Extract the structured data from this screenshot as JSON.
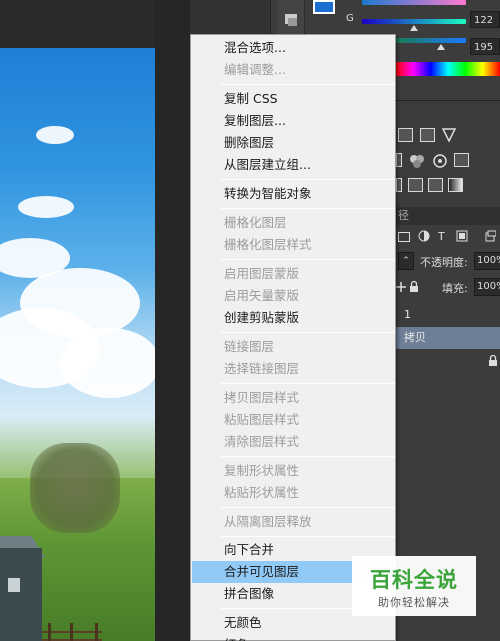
{
  "color_panel": {
    "g_label": "G",
    "g_value": "122",
    "b_value": "195",
    "foreground_color": "#1b6fcf"
  },
  "context_menu": {
    "items": [
      {
        "label": "混合选项...",
        "enabled": true
      },
      {
        "label": "编辑调整...",
        "enabled": false
      },
      {
        "label": "复制 CSS",
        "enabled": true
      },
      {
        "label": "复制图层...",
        "enabled": true
      },
      {
        "label": "删除图层",
        "enabled": true
      },
      {
        "label": "从图层建立组...",
        "enabled": true
      },
      {
        "label": "转换为智能对象",
        "enabled": true
      },
      {
        "label": "栅格化图层",
        "enabled": false
      },
      {
        "label": "栅格化图层样式",
        "enabled": false
      },
      {
        "label": "启用图层蒙版",
        "enabled": false
      },
      {
        "label": "启用矢量蒙版",
        "enabled": false
      },
      {
        "label": "创建剪贴蒙版",
        "enabled": true
      },
      {
        "label": "链接图层",
        "enabled": false
      },
      {
        "label": "选择链接图层",
        "enabled": false
      },
      {
        "label": "拷贝图层样式",
        "enabled": false
      },
      {
        "label": "粘贴图层样式",
        "enabled": false
      },
      {
        "label": "清除图层样式",
        "enabled": false
      },
      {
        "label": "复制形状属性",
        "enabled": false
      },
      {
        "label": "粘贴形状属性",
        "enabled": false
      },
      {
        "label": "从隔离图层释放",
        "enabled": false
      },
      {
        "label": "向下合并",
        "enabled": true
      },
      {
        "label": "合并可见图层",
        "enabled": true,
        "highlighted": true
      },
      {
        "label": "拼合图像",
        "enabled": true
      },
      {
        "label": "无颜色",
        "enabled": true
      },
      {
        "label": "红色",
        "enabled": true
      }
    ]
  },
  "layers_panel": {
    "tab_partial": "径",
    "opacity_label": "不透明度:",
    "opacity_value": "100%",
    "fill_label": "填充:",
    "fill_value": "100%",
    "layer1_label": "1",
    "layer_copy_label": "拷贝",
    "selected_color": "#6e7e96"
  },
  "watermark": {
    "title": "百科全说",
    "subtitle": "助你轻松解决"
  }
}
